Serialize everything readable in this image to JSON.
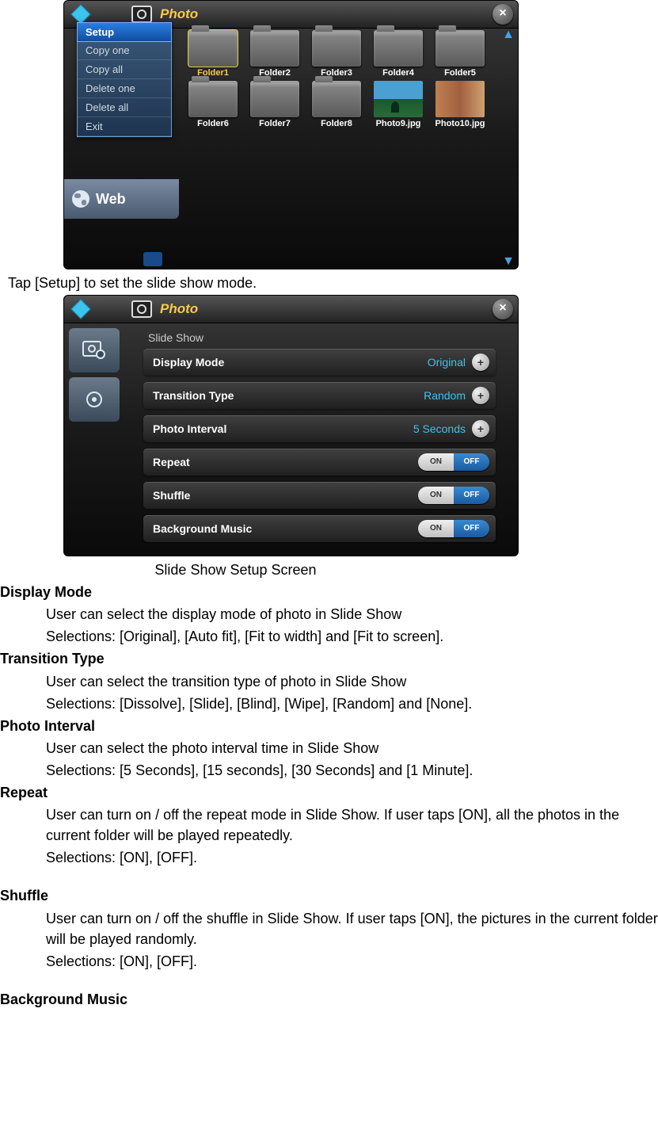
{
  "app": {
    "title": "Photo"
  },
  "ss1": {
    "context_menu": [
      "Setup",
      "Copy one",
      "Copy all",
      "Delete one",
      "Delete all",
      "Exit"
    ],
    "context_selected_index": 0,
    "web_label": "Web",
    "folders": [
      {
        "label": "Folder1",
        "type": "folder",
        "selected": true
      },
      {
        "label": "Folder2",
        "type": "folder"
      },
      {
        "label": "Folder3",
        "type": "folder"
      },
      {
        "label": "Folder4",
        "type": "folder"
      },
      {
        "label": "Folder5",
        "type": "folder"
      },
      {
        "label": "Folder6",
        "type": "folder"
      },
      {
        "label": "Folder7",
        "type": "folder"
      },
      {
        "label": "Folder8",
        "type": "folder"
      },
      {
        "label": "Photo9.jpg",
        "type": "thumb",
        "thumb": "beach"
      },
      {
        "label": "Photo10.jpg",
        "type": "thumb",
        "thumb": "people"
      }
    ]
  },
  "ss1_caption": "Tap [Setup] to set the slide show mode.",
  "ss2": {
    "section": "Slide Show",
    "rows": [
      {
        "label": "Display Mode",
        "value": "Original",
        "control": "plus"
      },
      {
        "label": "Transition Type",
        "value": "Random",
        "control": "plus"
      },
      {
        "label": "Photo Interval",
        "value": "5 Seconds",
        "control": "plus"
      },
      {
        "label": "Repeat",
        "control": "toggle",
        "on": "ON",
        "off": "OFF"
      },
      {
        "label": "Shuffle",
        "control": "toggle",
        "on": "ON",
        "off": "OFF"
      },
      {
        "label": "Background Music",
        "control": "toggle",
        "on": "ON",
        "off": "OFF"
      }
    ]
  },
  "ss2_caption": "Slide Show Setup Screen",
  "doc": {
    "display_mode": {
      "h": "Display Mode",
      "l1": "User can select the display mode of photo in Slide Show",
      "l2": "Selections: [Original], [Auto fit], [Fit to width] and [Fit to screen]."
    },
    "transition_type": {
      "h": "Transition Type",
      "l1": "User can select the transition type of photo in Slide Show",
      "l2": "Selections: [Dissolve], [Slide], [Blind], [Wipe], [Random] and [None]."
    },
    "photo_interval": {
      "h": "Photo Interval",
      "l1": "User can select the photo interval time in Slide Show",
      "l2": "Selections: [5 Seconds], [15 seconds], [30 Seconds] and [1 Minute]."
    },
    "repeat": {
      "h": "Repeat",
      "l1": "User can turn on / off the repeat mode in Slide Show. If user taps [ON], all the photos in the current folder will be played repeatedly.",
      "l2": "Selections: [ON], [OFF]."
    },
    "shuffle": {
      "h": "Shuffle",
      "l1": "User can turn on / off the shuffle in Slide Show. If user taps [ON], the pictures in the current folder will be played randomly.",
      "l2": "Selections: [ON], [OFF]."
    },
    "bg_music": {
      "h": "Background Music"
    }
  }
}
